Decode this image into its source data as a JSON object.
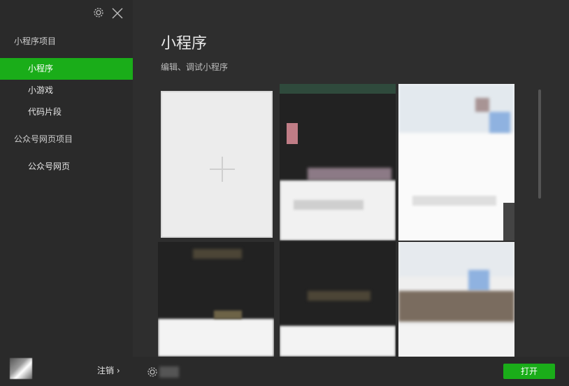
{
  "sidebar": {
    "icons": {
      "settings": "gear-icon",
      "close": "close-icon"
    },
    "sections": [
      {
        "label": "小程序项目",
        "items": [
          {
            "label": "小程序",
            "active": true
          },
          {
            "label": "小游戏",
            "active": false
          },
          {
            "label": "代码片段",
            "active": false
          }
        ]
      },
      {
        "label": "公众号网页项目",
        "items": [
          {
            "label": "公众号网页",
            "active": false
          }
        ]
      }
    ],
    "logout_label": "注销 ›"
  },
  "main": {
    "title": "小程序",
    "subtitle": "编辑、调试小程序",
    "new_project_icon": "plus-icon"
  },
  "footer": {
    "open_label": "打开",
    "settings_icon": "gear-icon"
  },
  "colors": {
    "accent": "#1aad19",
    "background": "#2e2e2e",
    "sidebar": "#2a2a2a"
  }
}
